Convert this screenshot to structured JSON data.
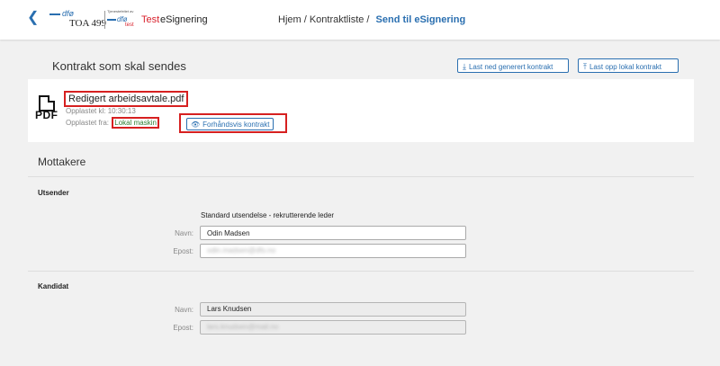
{
  "header": {
    "logo_org": "dfø",
    "logo_title": "TOA 499",
    "logo2_tagline": "Tjenestefeltet av",
    "logo2_org": "dfø",
    "logo2_test": "test",
    "env_label": "Test",
    "app_name": "eSignering",
    "breadcrumb_prefix": "Hjem / Kontraktliste /",
    "breadcrumb_current": "Send til eSignering"
  },
  "contract": {
    "title": "Kontrakt som skal sendes",
    "download_label": "Last ned generert kontrakt",
    "upload_label": "Last opp lokal kontrakt",
    "file_name": "Redigert arbeidsavtale.pdf",
    "file_icon_text": "PDF",
    "uploaded_time": "Opplastet kl: 10:30:13",
    "uploaded_from_label": "Opplastet fra:",
    "uploaded_from_value": "Lokal maskin",
    "preview_label": "Forhåndsvis kontrakt"
  },
  "recipients": {
    "title": "Mottakere",
    "sender": {
      "section": "Utsender",
      "subtitle": "Standard utsendelse - rekrutterende leder",
      "name_label": "Navn:",
      "name_value": "Odin Madsen",
      "email_label": "Epost:",
      "email_value": "odin.madsen@dfo.no"
    },
    "candidate": {
      "section": "Kandidat",
      "name_label": "Navn:",
      "name_value": "Lars Knudsen",
      "email_label": "Epost:",
      "email_value": "lars.knudsen@mail.no"
    }
  },
  "colors": {
    "accent": "#2a6fb0",
    "highlight_border": "#d62020",
    "test_red": "#d9232e",
    "source_green": "#2e7d32"
  },
  "icons": {
    "back": "chevron-left-icon",
    "download": "download-icon",
    "upload": "upload-icon",
    "preview": "eye-icon",
    "file": "pdf-file-icon"
  }
}
